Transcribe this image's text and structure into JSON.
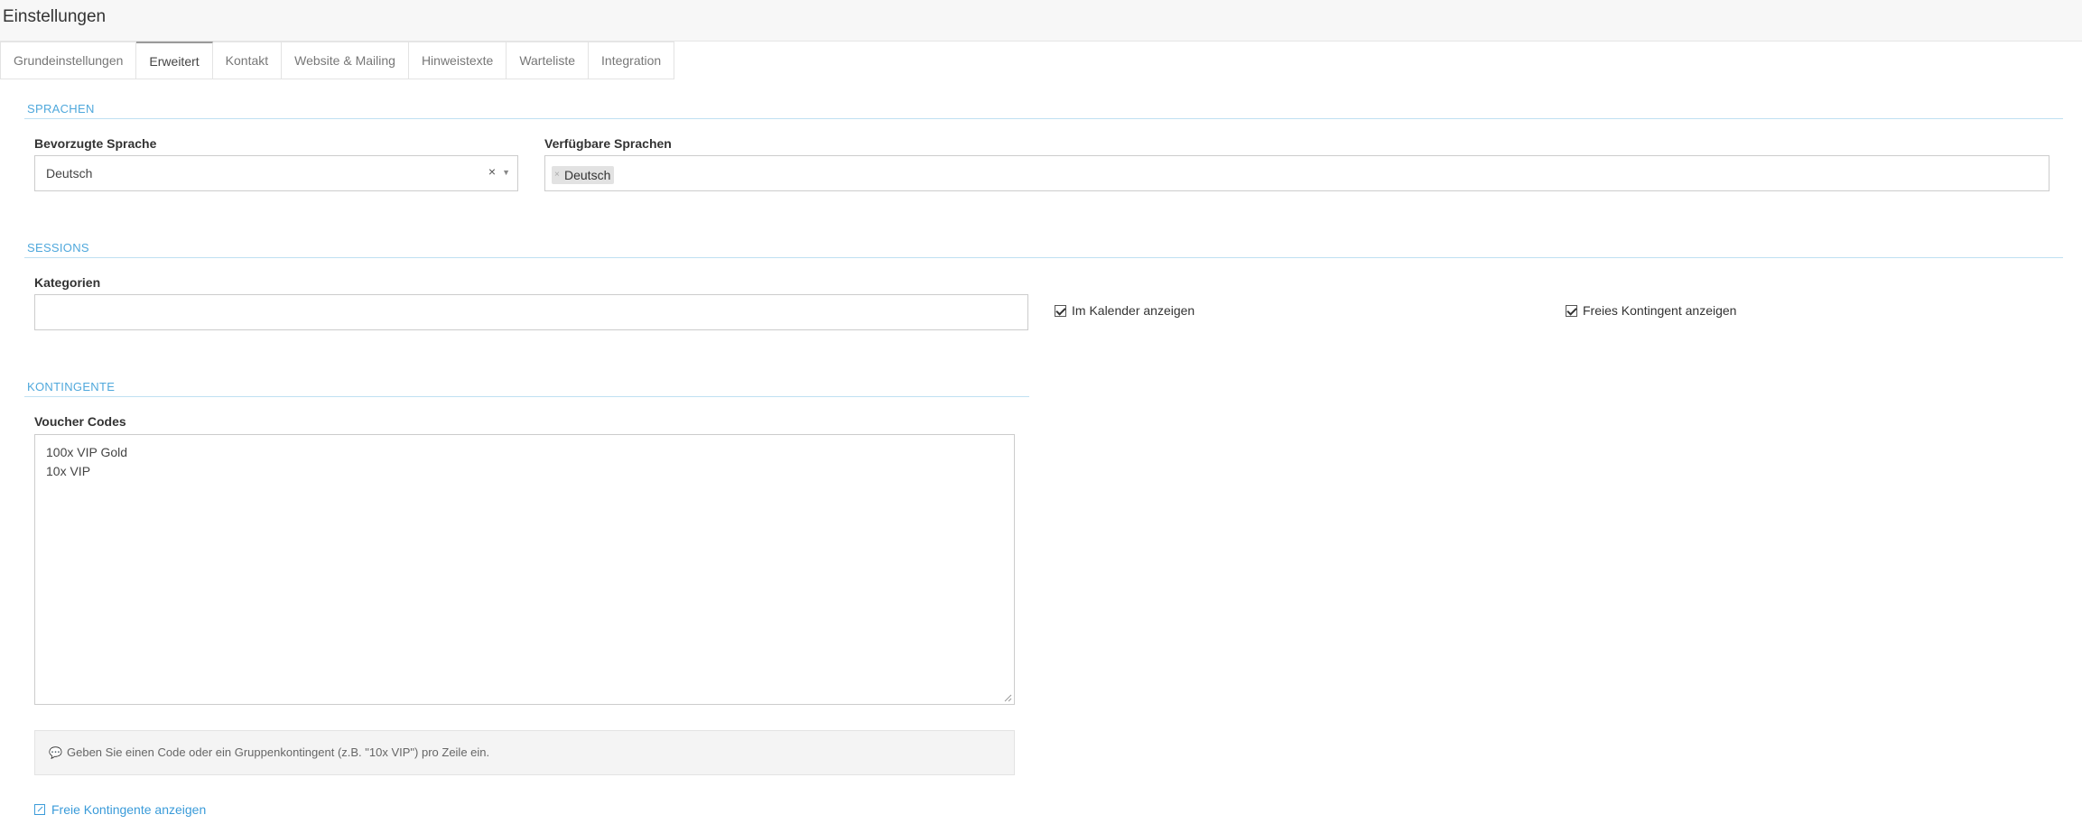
{
  "page": {
    "title": "Einstellungen"
  },
  "tabs": [
    {
      "label": "Grundeinstellungen"
    },
    {
      "label": "Erweitert",
      "active": true
    },
    {
      "label": "Kontakt"
    },
    {
      "label": "Website & Mailing"
    },
    {
      "label": "Hinweistexte"
    },
    {
      "label": "Warteliste"
    },
    {
      "label": "Integration"
    }
  ],
  "sprachen": {
    "section_title": "SPRACHEN",
    "preferred_label": "Bevorzugte Sprache",
    "preferred_value": "Deutsch",
    "clear_symbol": "×",
    "available_label": "Verfügbare Sprachen",
    "available_chips": [
      "Deutsch"
    ]
  },
  "sessions": {
    "section_title": "SESSIONS",
    "categories_label": "Kategorien",
    "categories_value": "",
    "show_in_calendar_label": "Im Kalender anzeigen",
    "show_in_calendar_checked": true,
    "show_free_quota_label": "Freies Kontingent anzeigen",
    "show_free_quota_checked": true
  },
  "kontingente": {
    "section_title": "KONTINGENTE",
    "voucher_label": "Voucher Codes",
    "voucher_codes": "100x VIP Gold\n10x VIP",
    "hint_text": "Geben Sie einen Code oder ein Gruppenkontingent (z.B. \"10x VIP\") pro Zeile ein.",
    "link_label": "Freie Kontingente anzeigen"
  },
  "colors": {
    "accent": "#4fa8dc",
    "link": "#3a9bd9"
  }
}
